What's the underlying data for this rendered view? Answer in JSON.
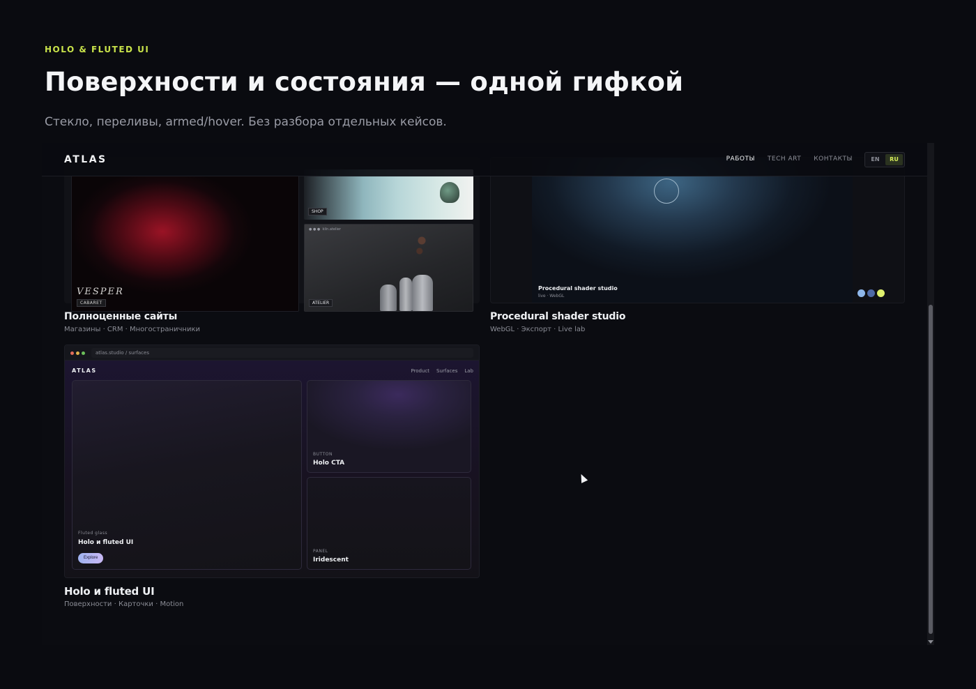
{
  "hero": {
    "eyebrow": "HOLO & FLUTED UI",
    "title": "Поверхности и состояния — одной гифкой",
    "subtitle": "Стекло, переливы, armed/hover. Без разбора отдельных кейсов."
  },
  "site": {
    "logo": "ATLAS",
    "nav": [
      "РАБОТЫ",
      "TECH ART",
      "КОНТАКТЫ"
    ],
    "nav_active": "РАБОТЫ",
    "lang": [
      "EN",
      "RU"
    ],
    "lang_active": "RU"
  },
  "cards": [
    {
      "title": "Полноценные сайты",
      "meta": "Магазины · CRM · Многостраничники",
      "thumbs": {
        "vesper_title": "VESPER",
        "vesper_tag": "CABARET",
        "shop_tag": "SHOP",
        "atelier_bar": "kiln.atelier",
        "atelier_tag": "ATELIER"
      }
    },
    {
      "title": "Procedural shader studio",
      "meta": "WebGL · Экспорт · Live lab",
      "thumbs": {
        "overlay_title": "Procedural shader studio",
        "overlay_sub": "live · WebGL",
        "swatches": [
          "#8fb7ea",
          "#4f6aa6",
          "#dff06e"
        ]
      }
    },
    {
      "title": "Holo и fluted UI",
      "meta": "Поверхности · Карточки · Motion",
      "thumbs": {
        "url": "atlas.studio / surfaces",
        "logo": "ATLAS",
        "nav": [
          "Product",
          "Surfaces",
          "Lab"
        ],
        "big_eyebrow": "Fluted glass",
        "big_title": "Holo и fluted UI",
        "explore": "Explore",
        "cta_eyebrow": "BUTTON",
        "cta_title": "Holo CTA",
        "panel_eyebrow": "PANEL",
        "panel_title": "Iridescent"
      }
    }
  ],
  "colors": {
    "accent": "#c8e24a",
    "background": "#0a0b10"
  }
}
